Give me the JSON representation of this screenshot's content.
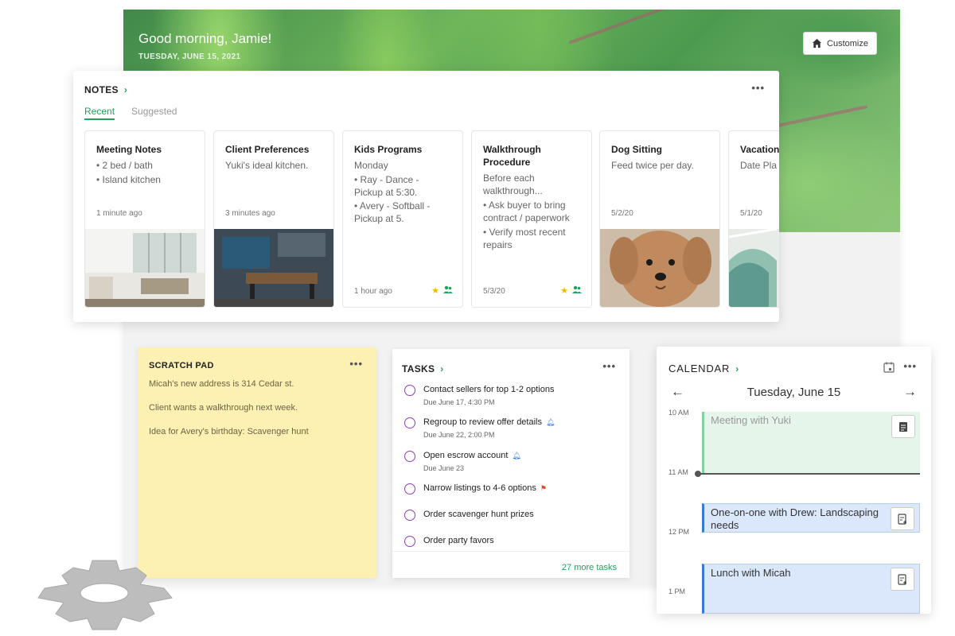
{
  "hero": {
    "greeting": "Good morning, Jamie!",
    "date": "TUESDAY, JUNE 15, 2021",
    "customize_label": "Customize"
  },
  "notes": {
    "title": "NOTES",
    "tabs": [
      "Recent",
      "Suggested"
    ],
    "items": [
      {
        "title": "Meeting Notes",
        "lines": [
          "• 2 bed / bath",
          "• Island kitchen"
        ],
        "date": "1 minute ago"
      },
      {
        "title": "Client Preferences",
        "lines": [
          "Yuki's ideal kitchen."
        ],
        "date": "3 minutes ago"
      },
      {
        "title": "Kids Programs",
        "lines": [
          "Monday",
          "• Ray - Dance -",
          "Pickup at 5:30.",
          "• Avery - Softball -",
          "Pickup at 5."
        ],
        "date": "1 hour ago"
      },
      {
        "title": "Walkthrough Procedure",
        "lines": [
          "Before each",
          "walkthrough...",
          "• Ask buyer to bring",
          "contract / paperwork",
          "• Verify most recent",
          "repairs"
        ],
        "date": "5/3/20"
      },
      {
        "title": "Dog Sitting",
        "lines": [
          "Feed twice per day."
        ],
        "date": "5/2/20"
      },
      {
        "title": "Vacation",
        "lines": [
          "Date Pla"
        ],
        "date": "5/1/20"
      }
    ]
  },
  "scratch": {
    "title": "SCRATCH PAD",
    "lines": [
      "Micah's new address is 314 Cedar st.",
      "Client wants a walkthrough next week.",
      "Idea for Avery's birthday: Scavenger hunt"
    ]
  },
  "tasks": {
    "title": "TASKS",
    "items": [
      {
        "name": "Contact sellers for top 1-2 options",
        "due": "Due June 17, 4:30 PM",
        "flag": ""
      },
      {
        "name": "Regroup to review offer details",
        "due": "Due June 22, 2:00 PM",
        "flag": "bell-icon"
      },
      {
        "name": "Open escrow account",
        "due": "Due June 23",
        "flag": "bell-icon"
      },
      {
        "name": "Narrow listings to 4-6 options",
        "due": "",
        "flag": "flag-icon"
      },
      {
        "name": "Order scavenger hunt prizes",
        "due": "",
        "flag": ""
      },
      {
        "name": "Order party favors",
        "due": "",
        "flag": ""
      }
    ],
    "more_label": "27 more tasks"
  },
  "calendar": {
    "title": "CALENDAR",
    "date": "Tuesday, June 15",
    "hours": [
      "10 AM",
      "11 AM",
      "12 PM",
      "1 PM"
    ],
    "events": [
      {
        "title": "Meeting with Yuki"
      },
      {
        "title": "One-on-one with Drew: Landscaping needs"
      },
      {
        "title": "Lunch with Micah"
      }
    ]
  },
  "colors": {
    "accent": "#1fa35c",
    "scratch_bg": "#fdf0b3",
    "event_blue": "#dbe8fb",
    "event_green": "#e6f5ea"
  }
}
